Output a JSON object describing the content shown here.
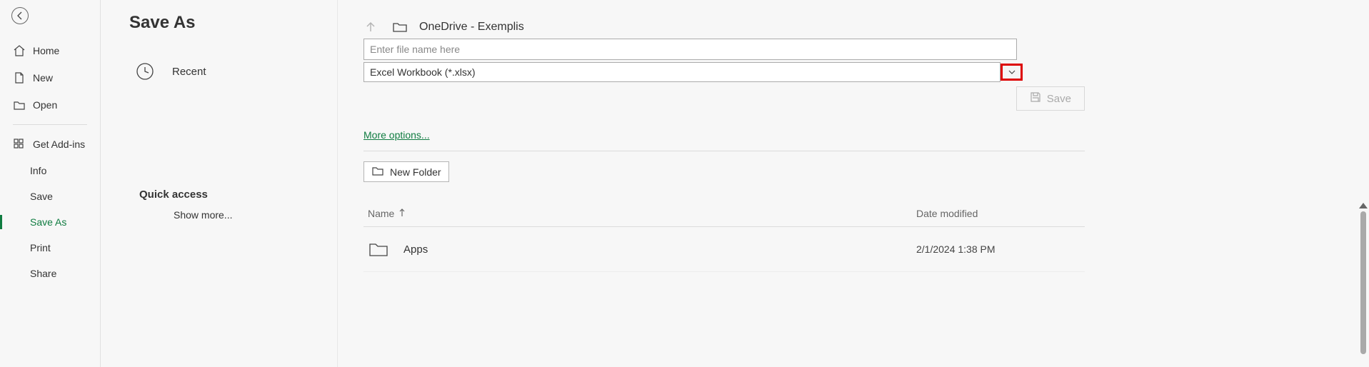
{
  "sidebar": {
    "home": "Home",
    "new": "New",
    "open": "Open",
    "get_addins": "Get Add-ins",
    "info": "Info",
    "save": "Save",
    "save_as": "Save As",
    "print": "Print",
    "share": "Share"
  },
  "page": {
    "title": "Save As"
  },
  "locations": {
    "recent": "Recent",
    "quick_access": "Quick access",
    "show_more": "Show more..."
  },
  "breadcrumb": {
    "path": "OneDrive - Exemplis"
  },
  "filename": {
    "placeholder": "Enter file name here",
    "value": ""
  },
  "filetype": {
    "selected": "Excel Workbook (*.xlsx)"
  },
  "actions": {
    "save": "Save",
    "more_options": "More options...",
    "new_folder": "New Folder"
  },
  "columns": {
    "name": "Name",
    "date": "Date modified"
  },
  "files": [
    {
      "name": "Apps",
      "date": "2/1/2024 1:38 PM",
      "type": "folder"
    }
  ]
}
